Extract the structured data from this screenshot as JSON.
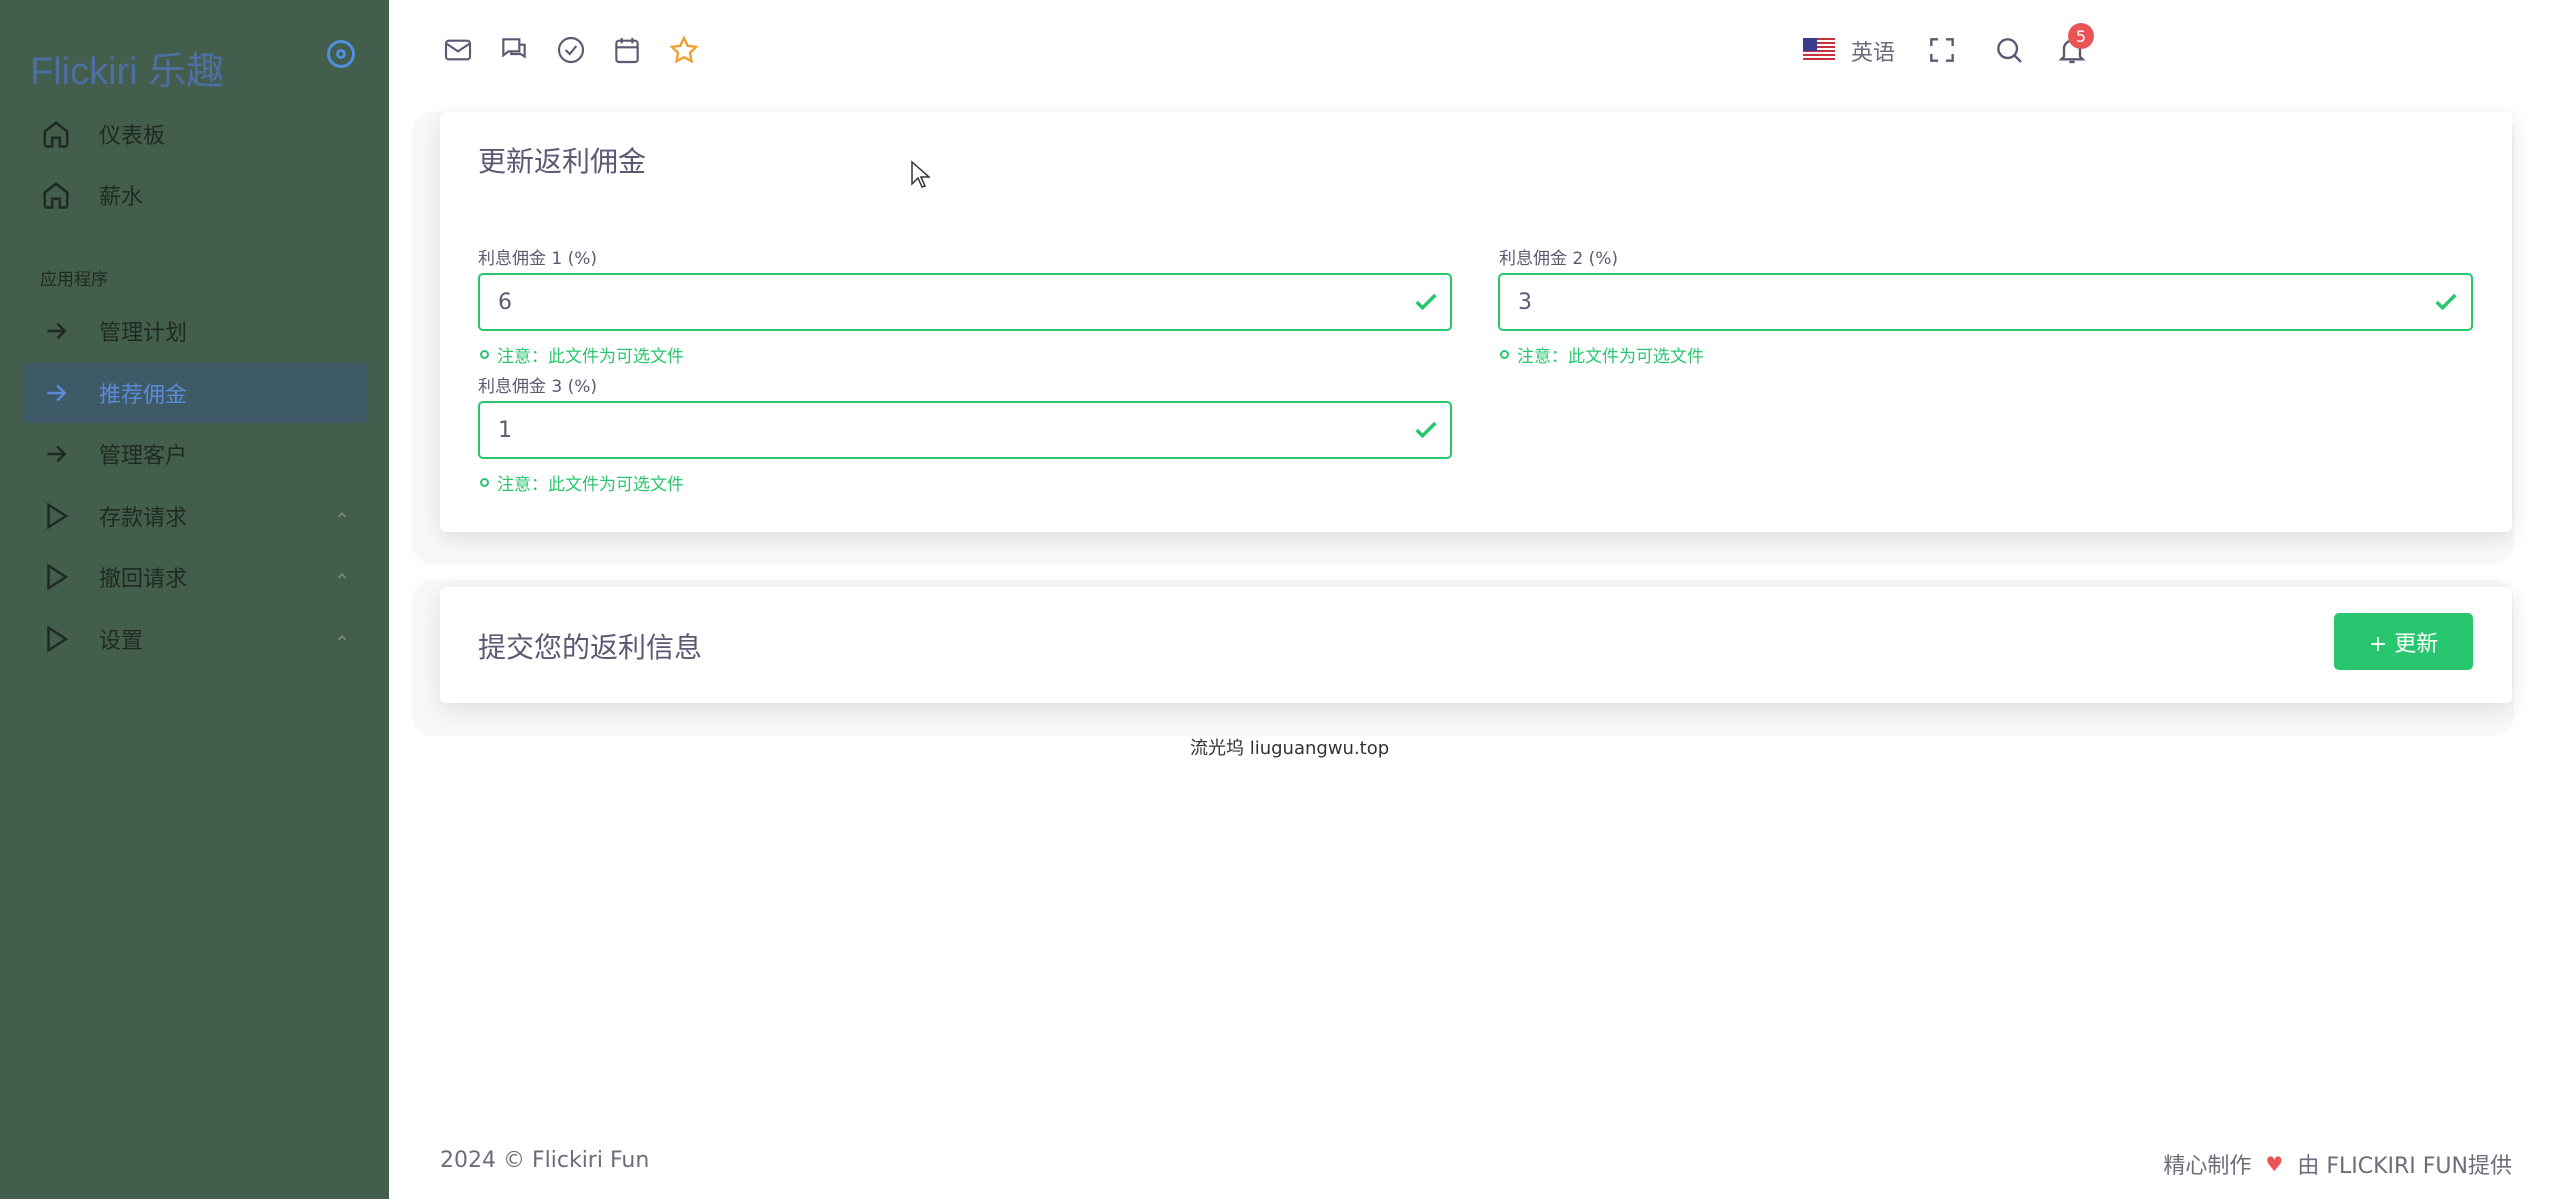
{
  "sidebar": {
    "brand": "Flickiri 乐趣",
    "section_label": "应用程序",
    "items": [
      {
        "label": "仪表板",
        "icon": "home-icon"
      },
      {
        "label": "薪水",
        "icon": "home-icon"
      },
      {
        "label": "管理计划",
        "icon": "arrow-right-icon"
      },
      {
        "label": "推荐佣金",
        "icon": "arrow-right-icon",
        "active": true
      },
      {
        "label": "管理客户",
        "icon": "arrow-right-icon"
      },
      {
        "label": "存款请求",
        "icon": "play-icon",
        "expandable": true
      },
      {
        "label": "撤回请求",
        "icon": "play-icon",
        "expandable": true
      },
      {
        "label": "设置",
        "icon": "play-icon",
        "expandable": true
      }
    ]
  },
  "topbar": {
    "icons": [
      "mail-icon",
      "chat-icon",
      "check-circle-icon",
      "calendar-icon",
      "star-icon"
    ],
    "language": "英语",
    "notification_count": "5"
  },
  "form_card": {
    "title": "更新返利佣金",
    "fields": [
      {
        "label": "利息佣金 1 (%)",
        "value": "6",
        "note": "注意：此文件为可选文件"
      },
      {
        "label": "利息佣金 2 (%)",
        "value": "3",
        "note": "注意：此文件为可选文件"
      },
      {
        "label": "利息佣金 3 (%)",
        "value": "1",
        "note": "注意：此文件为可选文件"
      }
    ]
  },
  "submit_card": {
    "title": "提交您的返利信息",
    "button_label": "+ 更新"
  },
  "watermark": "流光坞 liuguangwu.top",
  "footer": {
    "copyright": "2024 © Flickiri Fun",
    "made_with": "精心制作",
    "by": "由 FLICKIRI FUN提供"
  },
  "colors": {
    "sidebar_bg": "#435e4c",
    "active_item_bg": "#3d5a66",
    "success": "#28c76f",
    "badge": "#ea5455",
    "star": "#f0a030"
  }
}
